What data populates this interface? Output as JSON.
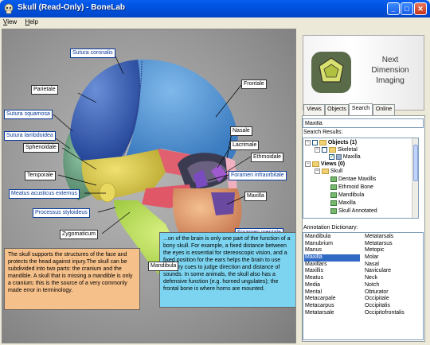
{
  "window": {
    "title": "Skull (Read-Only) - BoneLab",
    "minimize": "_",
    "maximize": "□",
    "close": "✕"
  },
  "menu": [
    {
      "label": "View",
      "underline": "V",
      "rest": "iew"
    },
    {
      "label": "Help",
      "underline": "H",
      "rest": "elp"
    }
  ],
  "labels": {
    "sutura_coronalis": "Sutura coronalis",
    "parietale": "Parietale",
    "frontale": "Frontale",
    "sutura_squamosa": "Sutura squamosa",
    "sutura_lambdoidea": "Sutura lambdoidea",
    "nasale": "Nasale",
    "sphenoidale": "Sphenoidale",
    "lacrimale": "Lacrimale",
    "ethmoidale": "Ethmoidale",
    "foramen_infraorbitale": "Foramen infraorbitale",
    "temporale": "Temporale",
    "meatus": "Meatus acusticus externus",
    "maxilla": "Maxilla",
    "processus": "Processus styloideus",
    "zygomaticum": "Zygomaticum",
    "foramen_mentale": "Foramen mentale",
    "mandibula": "Mandibula"
  },
  "descriptions": {
    "orange": "The skull supports the structures of the face and protects the head against injury.The skull can be subdivided into two parts: the cranium and the mandible. A skull that is missing a mandible is only a cranium; this is the source of a very commonly made error in terminology.",
    "blue": "...on of the brain is only one part of the function of a bony skull. For example, a fixed distance between the eyes is essential for stereoscopic vision, and a fixed position for the ears helps the brain to use auditory cues to judge direction and distance of sounds. In some animals, the skull also has a defensive function (e.g. horned ungulates); the frontal bone is where horns are mounted."
  },
  "logo": {
    "line1": "Next",
    "line2": "Dimension",
    "line3": "Imaging"
  },
  "tabs": [
    {
      "label": "Views",
      "active": false
    },
    {
      "label": "Objects",
      "active": false
    },
    {
      "label": "Search",
      "active": true
    },
    {
      "label": "Online",
      "active": false
    }
  ],
  "search": {
    "value": "Maxilla",
    "results_label": "Search Results:"
  },
  "tree": {
    "objects": "Objects (1)",
    "skeletal": "Skeletal",
    "maxilla_obj": "Maxilla",
    "views": "Views (0)",
    "skull": "Skull",
    "children": [
      "Dentae Maxillis",
      "Ethmoid Bone",
      "Mandibula",
      "Maxilla",
      "Skull Annotated"
    ]
  },
  "dictionary": {
    "label": "Annotation Dictionary:",
    "col1": [
      "Mandibula",
      "Manubrium",
      "Manus",
      "Maxilla",
      "Maxillars",
      "Maxillis",
      "Meatus",
      "Media",
      "Mental",
      "Metacarpale",
      "Metacarpus",
      "Metatarsale"
    ],
    "col2": [
      "Metatarsals",
      "Metatarsus",
      "Metopic",
      "Molar",
      "Nasal",
      "Naviculare",
      "Neck",
      "Notch",
      "Obturator",
      "Occipitale",
      "Occipitalis",
      "Occipitofrontalis"
    ],
    "selected": "Maxilla"
  },
  "colors": {
    "titlebar": "#0054e3",
    "selection": "#316ac5",
    "desc_orange": "#f6c08a",
    "desc_blue": "#7dd4f0",
    "parietal": "#3f6fc0",
    "frontal": "#4a8fd0",
    "temporal": "#d8c84a",
    "mandible": "#b8e050",
    "maxilla": "#e8a070"
  }
}
